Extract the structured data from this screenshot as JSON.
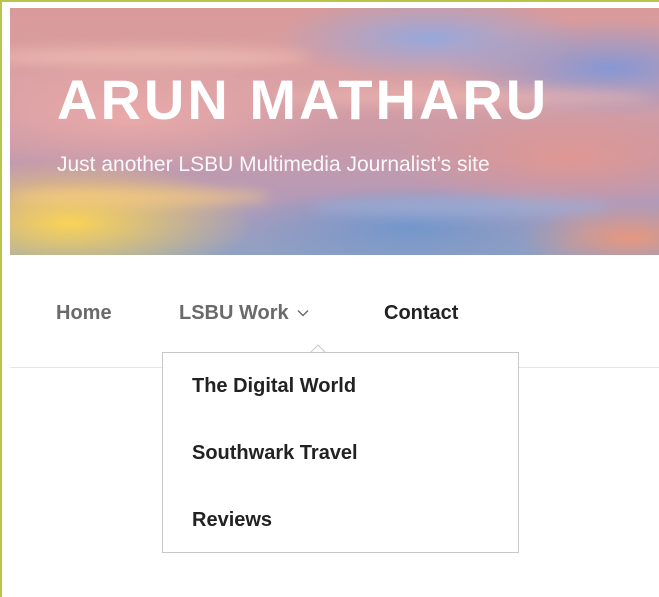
{
  "site": {
    "title": "ARUN MATHARU",
    "tagline": "Just another LSBU Multimedia Journalist’s site"
  },
  "nav": {
    "items": [
      {
        "label": "Home"
      },
      {
        "label": "LSBU Work",
        "has_submenu": true,
        "expanded": true
      },
      {
        "label": "Contact"
      }
    ],
    "submenu": [
      {
        "label": "The Digital World"
      },
      {
        "label": "Southwark Travel"
      },
      {
        "label": "Reviews"
      }
    ]
  },
  "icons": {
    "submenu_indicator": "chevron-down-icon"
  },
  "colors": {
    "frame_border": "#b9c44a",
    "nav_muted": "#6a6a6a",
    "nav_text": "#222222",
    "dropdown_border": "#c8c8c8"
  }
}
